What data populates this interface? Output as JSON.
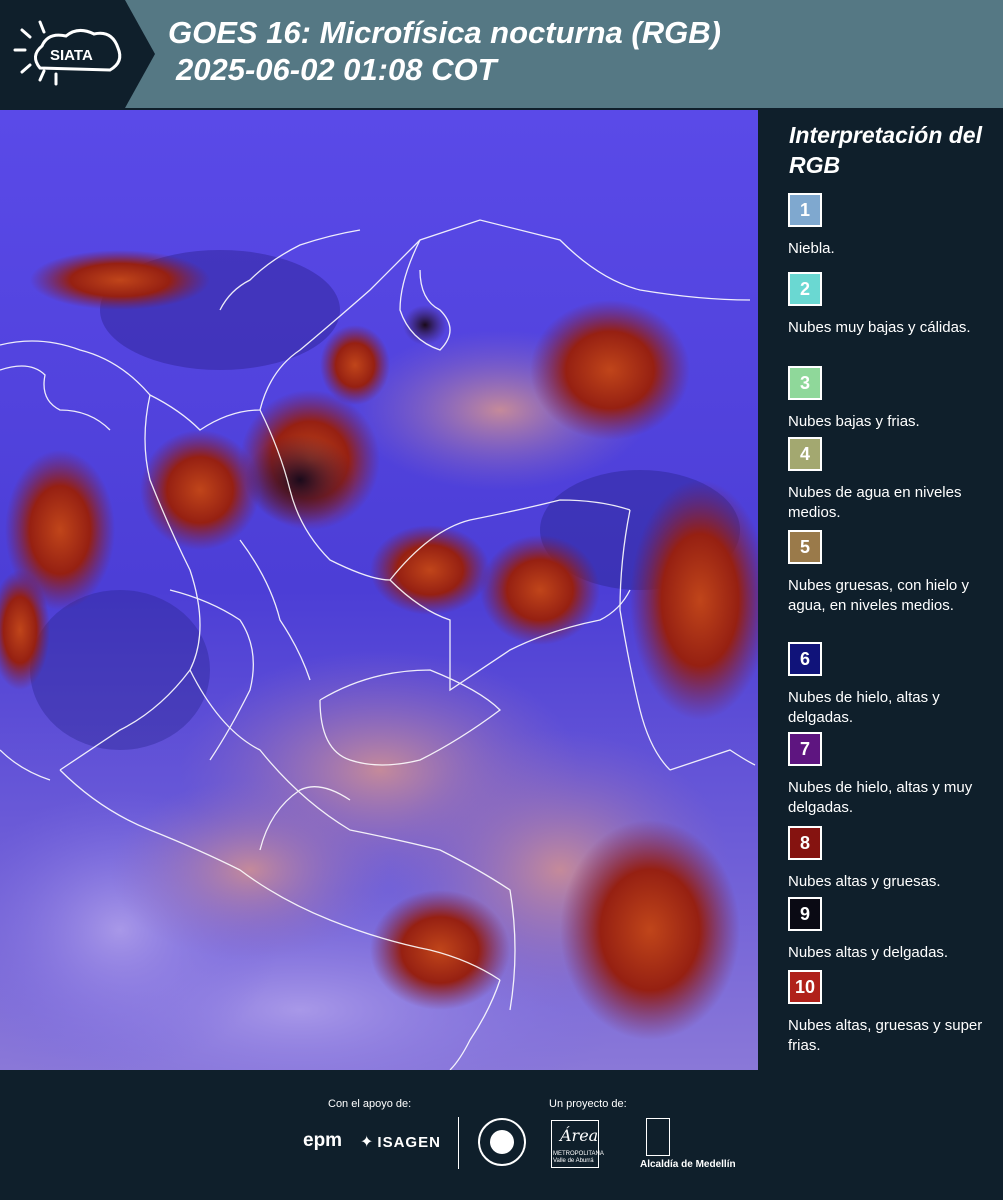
{
  "header": {
    "logo_text": "SIATA",
    "title_line1": "GOES 16: Microfísica nocturna (RGB)",
    "title_line2": "2025-06-02 01:08 COT"
  },
  "legend": {
    "title": "Interpretación del RGB",
    "items": [
      {
        "number": "1",
        "label": "Niebla.",
        "color": "#7fa8cf"
      },
      {
        "number": "2",
        "label": "Nubes muy bajas y cálidas.",
        "color": "#6ad8d2"
      },
      {
        "number": "3",
        "label": "Nubes bajas y frias.",
        "color": "#8fd89a"
      },
      {
        "number": "4",
        "label": "Nubes de agua en niveles medios.",
        "color": "#a3a870"
      },
      {
        "number": "5",
        "label": "Nubes gruesas, con hielo y agua, en niveles medios.",
        "color": "#9a7a4a"
      },
      {
        "number": "6",
        "label": "Nubes de hielo, altas y delgadas.",
        "color": "#10137a"
      },
      {
        "number": "7",
        "label": "Nubes de hielo, altas y muy delgadas.",
        "color": "#5e1580"
      },
      {
        "number": "8",
        "label": "Nubes altas y gruesas.",
        "color": "#851310"
      },
      {
        "number": "9",
        "label": "Nubes altas y delgadas.",
        "color": "#0a0a14"
      },
      {
        "number": "10",
        "label": "Nubes altas, gruesas y super frias.",
        "color": "#b0211a"
      }
    ]
  },
  "footer": {
    "support_label": "Con el apoyo de:",
    "project_label": "Un proyecto de:",
    "sponsor_1": "epm",
    "sponsor_2": "ISAGEN",
    "area_logo_word": "Área",
    "area_logo_sub": "METROPOLITANA Valle de Aburrá",
    "medellin_label": "Alcaldía de Medellín"
  }
}
